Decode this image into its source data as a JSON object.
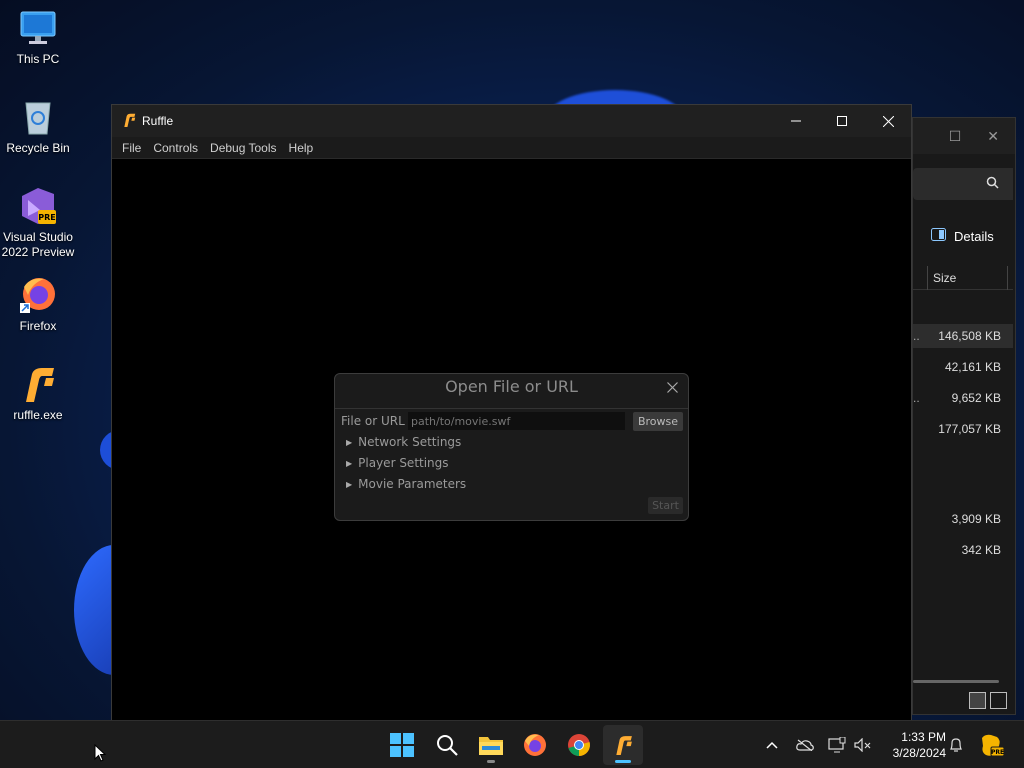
{
  "desktop": {
    "icons": [
      {
        "label": "This PC",
        "icon": "monitor-icon"
      },
      {
        "label": "Recycle Bin",
        "icon": "recycle-bin-icon"
      },
      {
        "label": "Visual Studio 2022 Preview",
        "icon": "visual-studio-icon"
      },
      {
        "label": "Firefox",
        "icon": "firefox-icon"
      },
      {
        "label": "ruffle.exe",
        "icon": "ruffle-icon"
      }
    ]
  },
  "explorer": {
    "details_label": "Details",
    "column_size": "Size",
    "rows": [
      {
        "prefix": "..",
        "size": "146,508 KB",
        "selected": true
      },
      {
        "prefix": "",
        "size": "42,161 KB"
      },
      {
        "prefix": "..",
        "size": "9,652 KB"
      },
      {
        "prefix": "",
        "size": "177,057 KB"
      },
      {
        "prefix": "",
        "size": "3,909 KB"
      },
      {
        "prefix": "",
        "size": "342 KB"
      }
    ]
  },
  "ruffle": {
    "title": "Ruffle",
    "menu": [
      "File",
      "Controls",
      "Debug Tools",
      "Help"
    ],
    "dialog": {
      "title": "Open File or URL",
      "field_label": "File or URL",
      "field_value": "",
      "field_placeholder": "path/to/movie.swf",
      "browse_label": "Browse",
      "sections": [
        "Network Settings",
        "Player Settings",
        "Movie Parameters"
      ],
      "start_label": "Start"
    }
  },
  "taskbar": {
    "apps": [
      "start-button",
      "search",
      "file-explorer",
      "firefox",
      "chrome",
      "ruffle"
    ],
    "time": "1:33 PM",
    "date": "3/28/2024",
    "pre_badge": "PRE"
  },
  "colors": {
    "accent": "#4cc2ff",
    "ruffle_orange": "#ffad33",
    "window_bg": "#202020"
  }
}
